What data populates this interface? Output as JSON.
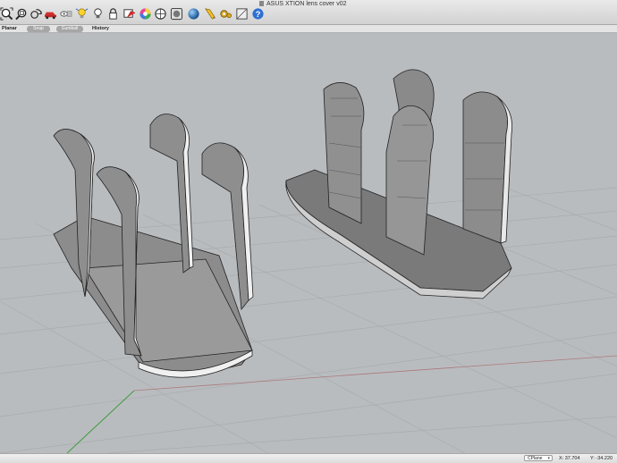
{
  "window": {
    "title": "ASUS XTION lens cover v02"
  },
  "toolbar": {
    "buttons": [
      "zoom-extents-icon",
      "zoom-window-icon",
      "pan-icon",
      "car-render-icon",
      "hide-icon",
      "lightbulb-icon",
      "lock-icon",
      "layer-color-icon",
      "color-wheel-icon",
      "properties-icon",
      "sphere-render-icon",
      "pencil-icon",
      "settings-gear-icon",
      "help-icon"
    ]
  },
  "options_bar": {
    "planar": "Planar",
    "snap": "Snap",
    "gumball": "Gumball",
    "history": "History"
  },
  "status": {
    "cplane": "CPlane",
    "x": "X: 37.704",
    "y": "Y: -34.220"
  },
  "colors": {
    "viewport_bg": "#b9bcbf",
    "grid_line": "#a9acaf",
    "x_axis": "#a24f4f",
    "y_axis": "#3f9b3f",
    "model_fill": "#8e8e8e",
    "model_face": "#f0f0f0"
  }
}
